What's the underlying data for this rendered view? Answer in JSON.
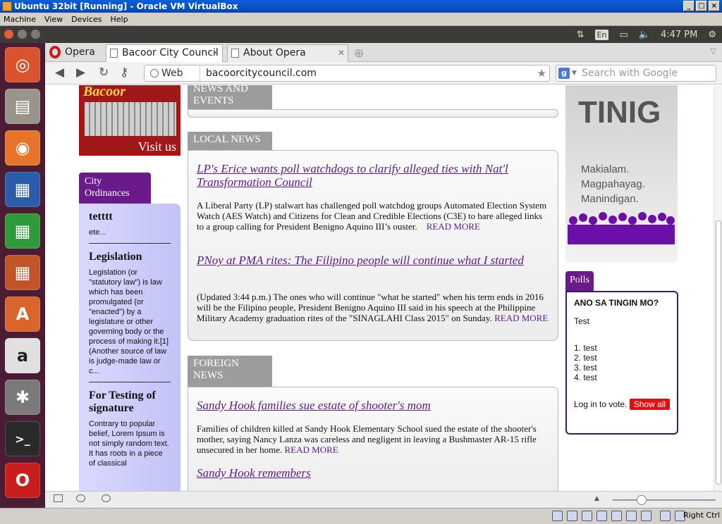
{
  "vbox": {
    "title": "Ubuntu 32bit [Running] - Oracle VM VirtualBox",
    "menu": [
      "Machine",
      "View",
      "Devices",
      "Help"
    ],
    "status_right": "Right Ctrl"
  },
  "unity": {
    "lang": "En",
    "time": "4:47 PM",
    "launcher_icons": [
      "ubuntu-dash-icon",
      "files-icon",
      "firefox-icon",
      "writer-icon",
      "calc-icon",
      "impress-icon",
      "software-center-icon",
      "amazon-icon",
      "system-settings-icon",
      "terminal-icon",
      "opera-icon"
    ]
  },
  "browser": {
    "menu_label": "Opera",
    "tabs": [
      {
        "label": "Bacoor City Council",
        "active": true
      },
      {
        "label": "About Opera",
        "active": false
      }
    ],
    "address": {
      "scheme_label": "Web",
      "url": "bacoorcitycouncil.com"
    },
    "search_placeholder": "Search with Google"
  },
  "page": {
    "banner": {
      "name": "Bacoor",
      "visit": "Visit us"
    },
    "ordinances": {
      "tab": "City Ordinances",
      "items": [
        {
          "title": "tetttt",
          "text": "ete..."
        },
        {
          "title": "Legislation",
          "text": "Legislation (or \"statutory law\") is law which has been promulgated (or \"enacted\") by a legislature or other governing body or the process of making it.[1] (Another source of law is judge-made law or c..."
        },
        {
          "title": "For Testing of signature",
          "text": "Contrary to popular belief, Lorem Ipsum is not simply random text. It has roots in a piece of classical"
        }
      ]
    },
    "news_events_head": "NEWS AND EVENTS",
    "local_news": {
      "head": "LOCAL NEWS",
      "articles": [
        {
          "title": "LP's Erice wants poll watchdogs to clarify alleged ties with Nat'l Transformation Council",
          "body": "A Liberal Party (LP) stalwart has challenged poll watchdog groups Automated Election System Watch (AES Watch) and Citizens for Clean and Credible Elections (C3E) to bare alleged links to a group calling for President Benigno Aquino III’s ouster.",
          "more": "READ MORE"
        },
        {
          "title": "PNoy at PMA rites: The Filipino people will continue what I started",
          "body": "(Updated 3:44 p.m.) The ones who will continue \"what he started\" when his term ends in 2016 will be the Filipino people, President Benigno Aquino III said in his speech at the Philippine Military Academy graduation rites of the \"SINAGLAHI Class 2015\" on Sunday.",
          "more": "READ MORE"
        }
      ]
    },
    "foreign_news": {
      "head": "FOREIGN NEWS",
      "articles": [
        {
          "title": "Sandy Hook families sue estate of shooter's mom",
          "body": "Families of children killed at Sandy Hook Elementary School sued the estate of the shooter's mother, saying Nancy Lanza was careless and negligent in leaving a Bushmaster AR-15 rifle unsecured in her home.",
          "more": "READ MORE"
        },
        {
          "title": "Sandy Hook remembers",
          "body": "",
          "more": ""
        }
      ]
    },
    "tinig": {
      "title": "TINIG",
      "slogan": [
        "Makialam.",
        "Magpahayag.",
        "Manindigan."
      ]
    },
    "polls": {
      "tab": "Polls",
      "question": "ANO SA TINGIN MO?",
      "poll_name": "Test",
      "options": [
        "1. test",
        "2. test",
        "3. test",
        "4. test"
      ],
      "login_text": "Log in to vote.",
      "show_all": "Show all"
    }
  },
  "colors": {
    "accent_purple": "#6a1a8a",
    "launcher_bg": "#4a1d35",
    "show_button": "#e01010"
  }
}
